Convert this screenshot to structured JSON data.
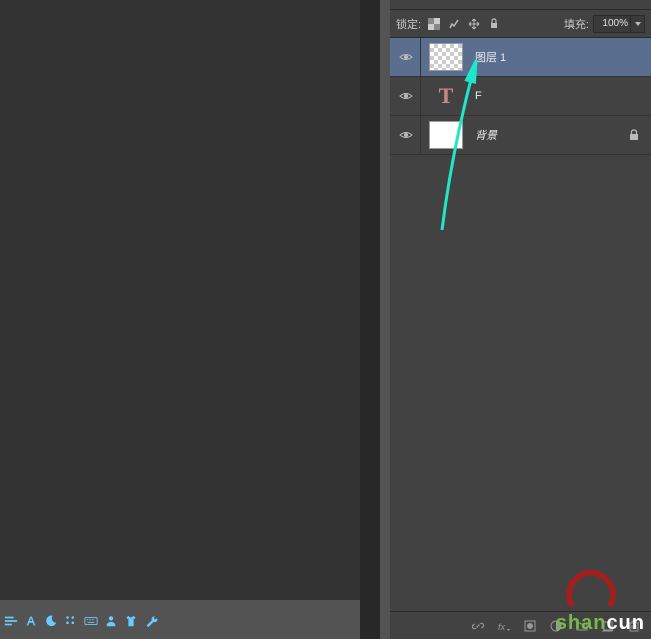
{
  "lockRow": {
    "lockLabel": "锁定:",
    "fillLabel": "填充:",
    "fillValue": "100%"
  },
  "layers": [
    {
      "name": "图层 1",
      "thumbType": "transparent",
      "italic": false,
      "locked": false,
      "selected": true
    },
    {
      "name": "F",
      "thumbType": "text",
      "thumbGlyph": "T",
      "italic": false,
      "locked": false,
      "selected": false
    },
    {
      "name": "背景",
      "thumbType": "white",
      "italic": true,
      "locked": true,
      "selected": false
    }
  ],
  "watermark": {
    "part1": "shan",
    "part2": "cun"
  },
  "optIcons": [
    "align-icon",
    "type-icon",
    "moon-icon",
    "dots-icon",
    "keyboard-icon",
    "person-icon",
    "shirt-icon",
    "wrench-icon"
  ],
  "lockIcons": [
    "checker-icon",
    "brush-icon",
    "move-icon",
    "lock-icon"
  ],
  "footerIcons": [
    "link-icon",
    "fx-icon",
    "mask-icon",
    "adjust-icon",
    "group-icon",
    "new-icon",
    "trash-icon"
  ]
}
